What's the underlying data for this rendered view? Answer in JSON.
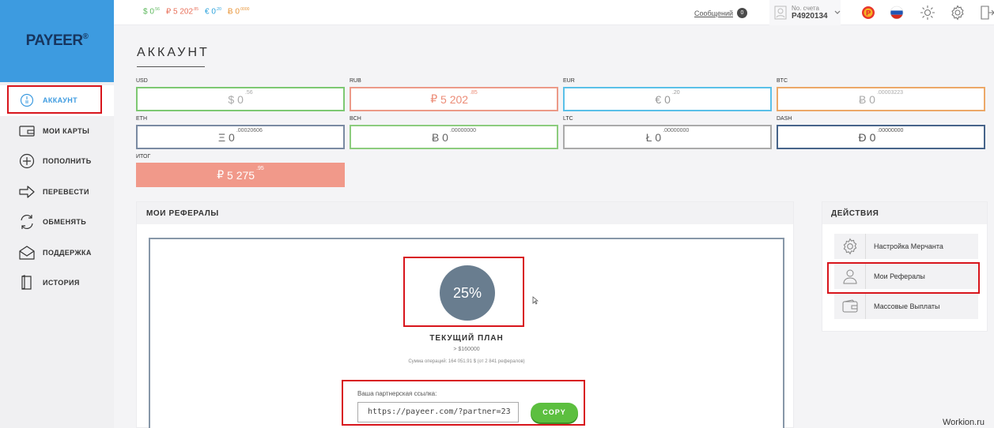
{
  "logo": {
    "text": "PAYEER",
    "mark": "®"
  },
  "sidebar": {
    "items": [
      {
        "label": "АККАУНТ",
        "icon": "account-icon"
      },
      {
        "label": "МОИ КАРТЫ",
        "icon": "card-icon"
      },
      {
        "label": "ПОПОЛНИТЬ",
        "icon": "plus-circle-icon"
      },
      {
        "label": "ПЕРЕВЕСТИ",
        "icon": "arrow-right-icon"
      },
      {
        "label": "ОБМЕНЯТЬ",
        "icon": "exchange-icon"
      },
      {
        "label": "ПОДДЕРЖКА",
        "icon": "envelope-icon"
      },
      {
        "label": "ИСТОРИЯ",
        "icon": "book-icon"
      }
    ]
  },
  "topbar": {
    "balances": {
      "usd": {
        "sym": "$",
        "main": "0",
        "frac": ".56"
      },
      "rub": {
        "sym": "₽",
        "main": "5 202",
        "frac": ".85"
      },
      "eur": {
        "sym": "€",
        "main": "0",
        "frac": ".20"
      },
      "btc": {
        "sym": "Ƀ",
        "main": "0",
        "frac": ".0000"
      }
    },
    "messages_label": "Сообщений",
    "messages_count": "0",
    "account_label": "No. счета",
    "account_number": "P4920134"
  },
  "page_title": "АККАУНТ",
  "wallets": {
    "usd": {
      "label": "USD",
      "sym": "$",
      "main": "0",
      "frac": ".56"
    },
    "rub": {
      "label": "RUB",
      "sym": "₽",
      "main": "5 202",
      "frac": ".85"
    },
    "eur": {
      "label": "EUR",
      "sym": "€",
      "main": "0",
      "frac": ".20"
    },
    "btc": {
      "label": "BTC",
      "sym": "Ƀ",
      "main": "0",
      "frac": ".00003223"
    },
    "eth": {
      "label": "ETH",
      "sym": "Ξ",
      "main": "0",
      "frac": ".00020606"
    },
    "bch": {
      "label": "BCH",
      "sym": "Ƀ",
      "main": "0",
      "frac": ".00000000"
    },
    "ltc": {
      "label": "LTC",
      "sym": "Ł",
      "main": "0",
      "frac": ".00000000"
    },
    "dash": {
      "label": "DASH",
      "sym": "Đ",
      "main": "0",
      "frac": ".00000000"
    },
    "total": {
      "label": "ИТОГ",
      "sym": "₽",
      "main": "5 275",
      "frac": ".95"
    }
  },
  "referrals": {
    "title": "МОИ РЕФЕРАЛЫ",
    "percent": "25%",
    "plan_title": "ТЕКУЩИЙ ПЛАН",
    "plan_threshold": "> $160000",
    "operations": "Сумма операций: 164 051.91 $ (от 2 841 рефералов)",
    "link_label": "Ваша партнерская ссылка:",
    "link_value": "https://payeer.com/?partner=23",
    "copy_label": "COPY"
  },
  "actions": {
    "title": "ДЕЙСТВИЯ",
    "items": [
      {
        "label": "Настройка Мерчанта",
        "icon": "gear-icon"
      },
      {
        "label": "Мои Рефералы",
        "icon": "users-icon"
      },
      {
        "label": "Массовые Выплаты",
        "icon": "wallet-icon"
      }
    ]
  },
  "watermark": "Workion.ru",
  "colors": {
    "brand_blue": "#3d9be0",
    "highlight_red": "#d8151c",
    "copy_green": "#5cbf3f",
    "total_salmon": "#f1998a",
    "plan_circle": "#697d8f"
  }
}
